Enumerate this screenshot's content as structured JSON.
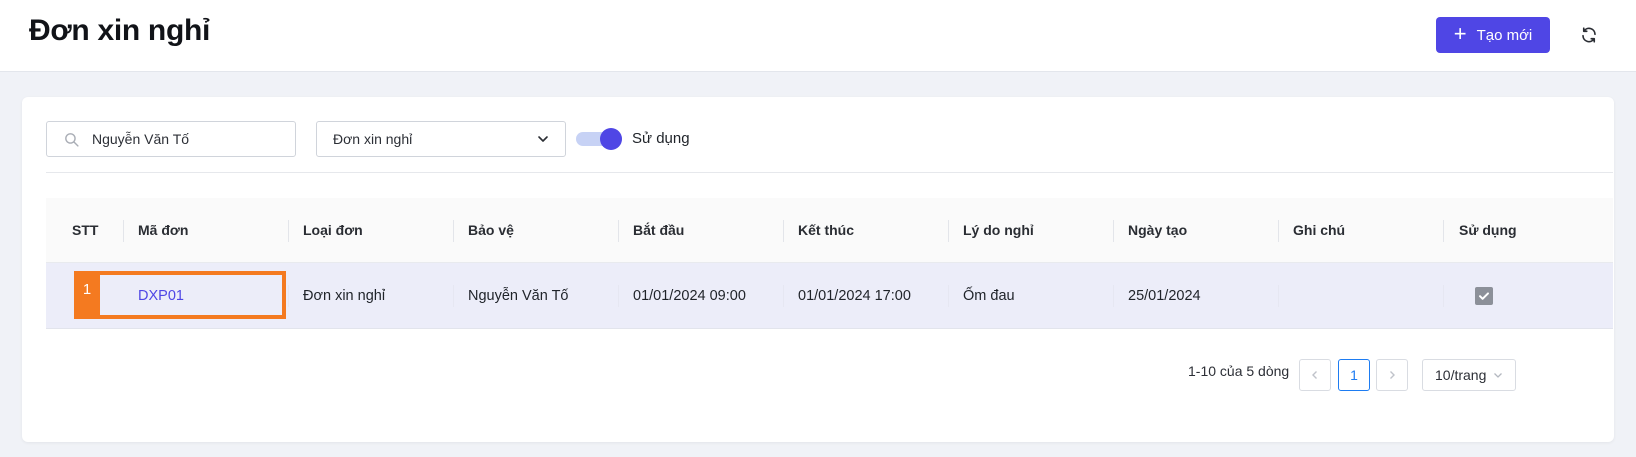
{
  "header": {
    "title": "Đơn xin nghỉ",
    "create_label": "Tạo mới"
  },
  "filters": {
    "search_value": "Nguyễn Văn Tố",
    "type_value": "Đơn xin nghỉ",
    "toggle_label": "Sử dụng",
    "toggle_on": true
  },
  "table": {
    "columns": [
      "STT",
      "Mã đơn",
      "Loại đơn",
      "Bảo vệ",
      "Bắt đầu",
      "Kết thúc",
      "Lý do nghỉ",
      "Ngày tạo",
      "Ghi chú",
      "Sử dụng"
    ],
    "rows": [
      {
        "stt": "1",
        "code": "DXP01",
        "type": "Đơn xin nghỉ",
        "guard": "Nguyễn Văn Tố",
        "start": "01/01/2024 09:00",
        "end": "01/01/2024 17:00",
        "reason": "Ốm đau",
        "created": "25/01/2024",
        "note": "",
        "active": true
      }
    ]
  },
  "pagination": {
    "summary": "1-10 của 5 dòng",
    "current_page": "1",
    "page_size": "10/trang"
  },
  "colors": {
    "accent": "#4f46e5",
    "highlight": "#f47a20",
    "selected_row": "#ecedf9"
  }
}
